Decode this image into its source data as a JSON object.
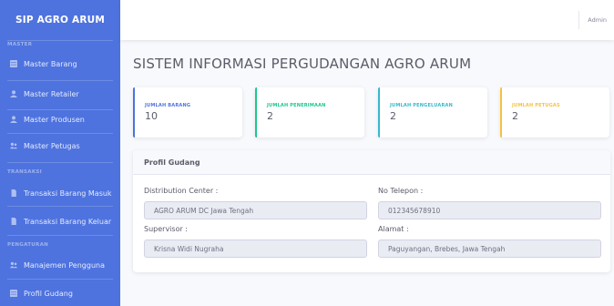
{
  "brand": "SIP AGRO ARUM",
  "sidebar": {
    "sections": [
      {
        "heading": "MASTER"
      },
      {
        "heading": "TRANSAKSI"
      },
      {
        "heading": "PENGATURAN"
      }
    ],
    "items": [
      {
        "label": "Master Barang",
        "icon": "table-icon"
      },
      {
        "label": "Master Retailer",
        "icon": "user-icon"
      },
      {
        "label": "Master Produsen",
        "icon": "user-icon"
      },
      {
        "label": "Master Petugas",
        "icon": "users-icon"
      },
      {
        "label": "Transaksi Barang Masuk",
        "icon": "document-icon"
      },
      {
        "label": "Transaksi Barang Keluar",
        "icon": "document-icon"
      },
      {
        "label": "Manajemen Pengguna",
        "icon": "users-icon"
      },
      {
        "label": "Profil Gudang",
        "icon": "table-icon"
      }
    ]
  },
  "topbar": {
    "user": "Admin"
  },
  "page_title": "SISTEM INFORMASI PERGUDANGAN AGRO ARUM",
  "cards": [
    {
      "label": "JUMLAH BARANG",
      "value": "10",
      "color": "#4e73df"
    },
    {
      "label": "JUMLAH PENERIMAAN",
      "value": "2",
      "color": "#1cc88a"
    },
    {
      "label": "JUMLAH PENGELUARAN",
      "value": "2",
      "color": "#36b9cc"
    },
    {
      "label": "JUMLAH PETUGAS",
      "value": "2",
      "color": "#f6c23e"
    }
  ],
  "profile": {
    "title": "Profil Gudang",
    "distribution_label": "Distribution Center :",
    "distribution_value": "AGRO ARUM DC Jawa Tengah",
    "phone_label": "No Telepon :",
    "phone_value": "012345678910",
    "supervisor_label": "Supervisor :",
    "supervisor_value": "Krisna Widi Nugraha",
    "address_label": "Alamat :",
    "address_value": "Paguyangan, Brebes, Jawa Tengah"
  }
}
